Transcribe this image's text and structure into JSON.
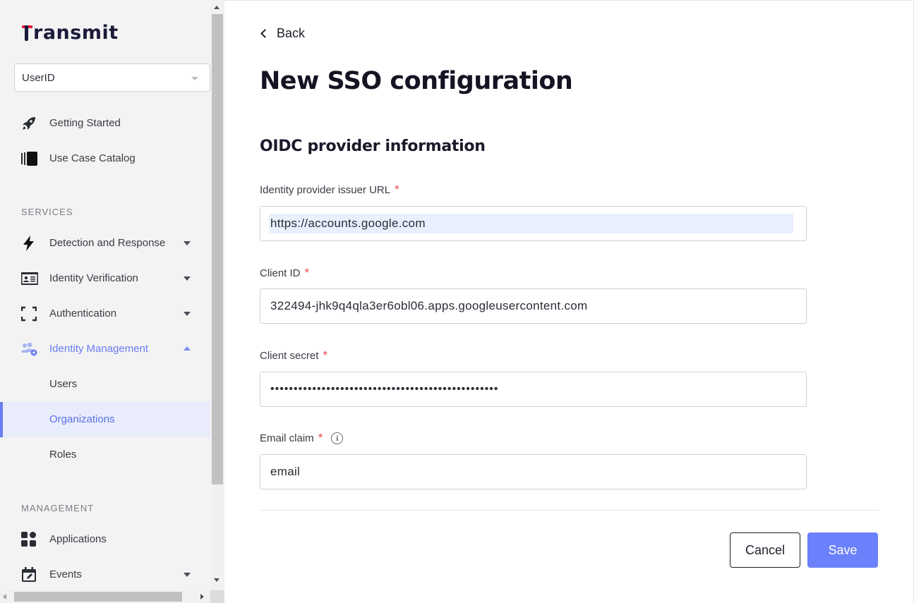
{
  "brand": {
    "logo_text": "ransmit",
    "logo_full": "transmit",
    "accent_color": "#6b80fb",
    "logo_red": "#e8173c"
  },
  "sidebar": {
    "app_selector": {
      "value": "UserID"
    },
    "top_items": [
      {
        "label": "Getting Started",
        "icon": "rocket-icon"
      },
      {
        "label": "Use Case Catalog",
        "icon": "catalog-icon"
      }
    ],
    "services_title": "SERVICES",
    "services": [
      {
        "label": "Detection and Response",
        "icon": "bolt-icon",
        "expandable": true
      },
      {
        "label": "Identity Verification",
        "icon": "id-card-icon",
        "expandable": true
      },
      {
        "label": "Authentication",
        "icon": "scan-frame-icon",
        "expandable": true
      },
      {
        "label": "Identity Management",
        "icon": "users-gear-icon",
        "expandable": true,
        "expanded": true
      }
    ],
    "identity_management_children": [
      {
        "label": "Users"
      },
      {
        "label": "Organizations",
        "selected": true
      },
      {
        "label": "Roles"
      }
    ],
    "management_title": "MANAGEMENT",
    "management": [
      {
        "label": "Applications",
        "icon": "apps-grid-icon"
      },
      {
        "label": "Events",
        "icon": "calendar-icon",
        "expandable": true
      }
    ]
  },
  "main": {
    "back_label": "Back",
    "title": "New SSO configuration",
    "section_title": "OIDC provider information",
    "fields": {
      "issuer_url": {
        "label": "Identity provider issuer URL",
        "required_mark": "*",
        "value": "https://accounts.google.com"
      },
      "client_id": {
        "label": "Client ID",
        "required_mark": "*",
        "value": "322494-jhk9q4qla3er6obl06.apps.googleusercontent.com"
      },
      "client_secret": {
        "label": "Client secret",
        "required_mark": "*",
        "value": "•••••••••••••••••••••••••••••••••••••••••••••••••"
      },
      "email_claim": {
        "label": "Email claim",
        "required_mark": "*",
        "info_icon": "i",
        "value": "email"
      }
    },
    "actions": {
      "cancel_label": "Cancel",
      "save_label": "Save"
    }
  }
}
